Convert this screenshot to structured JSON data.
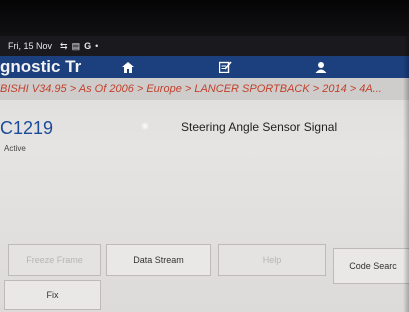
{
  "status_bar": {
    "date": "Fri, 15 Nov",
    "icons": [
      "usb-icon",
      "message-icon",
      "google-icon",
      "dot-icon"
    ]
  },
  "header": {
    "title": "gnostic Tr",
    "nav": [
      {
        "icon": "home-icon"
      },
      {
        "icon": "report-icon"
      },
      {
        "icon": "user-icon"
      }
    ]
  },
  "breadcrumb": "BISHI V34.95 > As Of 2006 > Europe > LANCER SPORTBACK > 2014 > 4A...",
  "dtc": {
    "code": "C1219",
    "status": "Active",
    "description": "Steering Angle Sensor Signal"
  },
  "buttons": {
    "freeze_frame": "Freeze Frame",
    "data_stream": "Data Stream",
    "help": "Help",
    "code_search": "Code Searc",
    "fix": "Fix"
  },
  "colors": {
    "header_bg": "#1c3f7e",
    "breadcrumb_text": "#c2402c",
    "dtc_code": "#1a4b9b"
  }
}
